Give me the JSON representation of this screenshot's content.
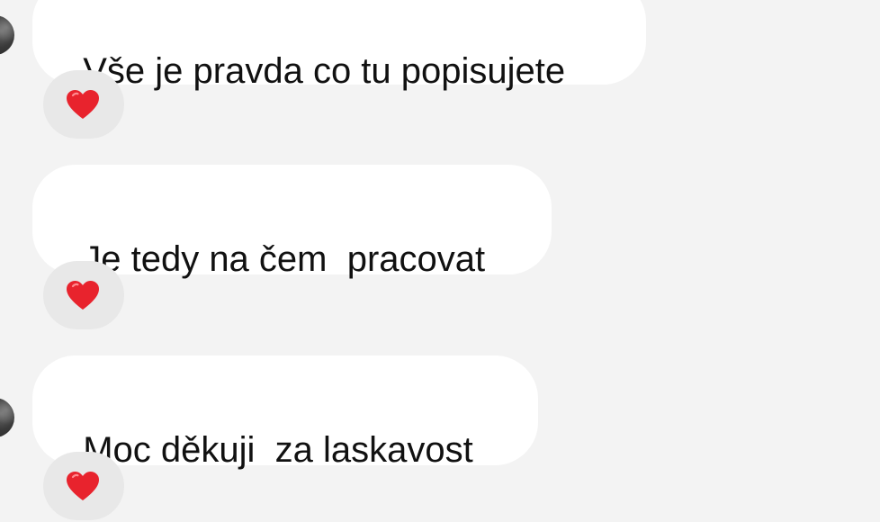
{
  "messages": [
    {
      "text": "Vše je pravda co tu popisujete",
      "reaction": "heart-icon",
      "has_avatar": true
    },
    {
      "text": "Je tedy na čem  pracovat",
      "reaction": "heart-icon",
      "has_avatar": false
    },
    {
      "text": "Moc děkuji  za laskavost",
      "reaction": "heart-icon",
      "has_avatar": true
    }
  ],
  "colors": {
    "background": "#f3f3f3",
    "bubble": "#ffffff",
    "reaction_pill": "#e8e8e8",
    "heart": "#e8232d",
    "text": "#111111"
  }
}
